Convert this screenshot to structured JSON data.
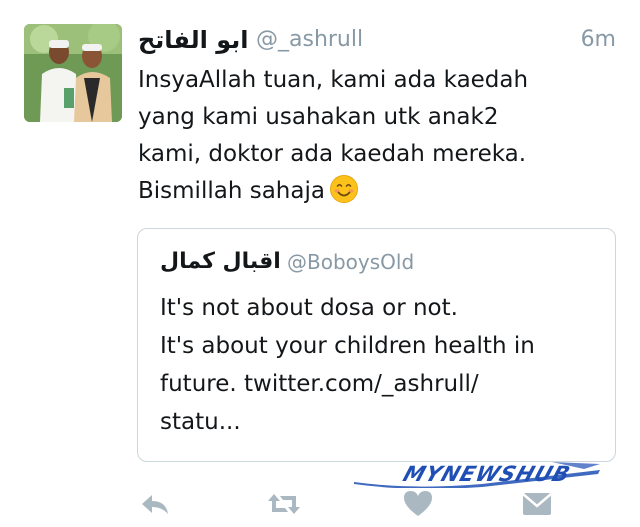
{
  "tweet": {
    "display_name": "ابو الفاتح",
    "handle": "@_ashrull",
    "timestamp": "6m",
    "text_lines": [
      "InsyaAllah tuan, kami ada kaedah",
      "yang kami usahakan utk anak2",
      "kami, doktor ada kaedah mereka.",
      "Bismillah sahaja"
    ],
    "emoji": "smiling-face-emoji"
  },
  "quote": {
    "display_name": "اقبال كمال",
    "handle": "@BoboysOld",
    "text_lines": [
      "It's not about dosa or not.",
      "It's about your children health in",
      "future. twitter.com/_ashrull/",
      "statu..."
    ]
  },
  "watermark": {
    "text": "MYNEWSHUB"
  },
  "actions": {
    "icons": [
      "reply-icon",
      "retweet-icon",
      "like-heart-icon",
      "direct-message-icon"
    ]
  },
  "colors": {
    "text": "#14171a",
    "secondary": "#8899a6",
    "border": "#ccd6dd",
    "action_icon": "#aab8c2",
    "watermark": "#1f4fb5"
  }
}
